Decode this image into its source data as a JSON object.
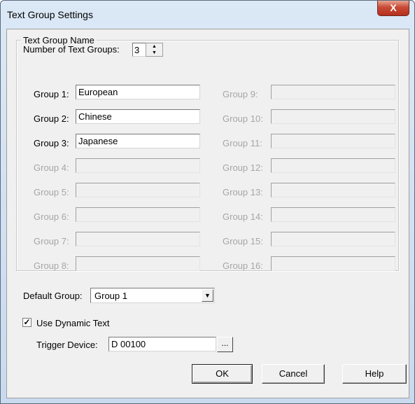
{
  "window": {
    "title": "Text Group Settings",
    "close_glyph": "X"
  },
  "num_groups": {
    "label": "Number of Text Groups:",
    "value": "3",
    "up_glyph": "▲",
    "down_glyph": "▼"
  },
  "group_box": {
    "title": "Text Group Name"
  },
  "groups_left": [
    {
      "label": "Group 1:",
      "value": "European"
    },
    {
      "label": "Group 2:",
      "value": "Chinese"
    },
    {
      "label": "Group 3:",
      "value": "Japanese"
    },
    {
      "label": "Group 4:",
      "value": ""
    },
    {
      "label": "Group 5:",
      "value": ""
    },
    {
      "label": "Group 6:",
      "value": ""
    },
    {
      "label": "Group 7:",
      "value": ""
    },
    {
      "label": "Group 8:",
      "value": ""
    }
  ],
  "groups_right": [
    {
      "label": "Group 9:",
      "value": ""
    },
    {
      "label": "Group 10:",
      "value": ""
    },
    {
      "label": "Group 11:",
      "value": ""
    },
    {
      "label": "Group 12:",
      "value": ""
    },
    {
      "label": "Group 13:",
      "value": ""
    },
    {
      "label": "Group 14:",
      "value": ""
    },
    {
      "label": "Group 15:",
      "value": ""
    },
    {
      "label": "Group 16:",
      "value": ""
    }
  ],
  "default_group": {
    "label": "Default Group:",
    "value": "Group 1",
    "arrow_glyph": "▼"
  },
  "dynamic_text": {
    "label": "Use Dynamic Text",
    "checked_glyph": "✓"
  },
  "trigger": {
    "label": "Trigger Device:",
    "value": "D 00100",
    "browse_label": "..."
  },
  "buttons": {
    "ok": "OK",
    "cancel": "Cancel",
    "help": "Help"
  }
}
